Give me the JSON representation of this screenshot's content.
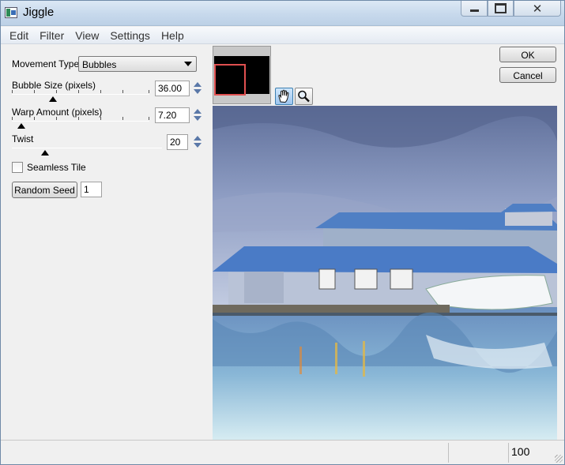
{
  "window": {
    "title": "Jiggle"
  },
  "menu": [
    "Edit",
    "Filter",
    "View",
    "Settings",
    "Help"
  ],
  "controls": {
    "movement_type": {
      "label": "Movement Type:",
      "value": "Bubbles"
    },
    "bubble_size": {
      "label": "Bubble Size (pixels)",
      "value": "36.00",
      "slider_fraction": 0.3
    },
    "warp_amount": {
      "label": "Warp Amount (pixels)",
      "value": "7.20",
      "slider_fraction": 0.07
    },
    "twist": {
      "label": "Twist",
      "value": "20",
      "slider_fraction": 0.22
    },
    "seamless_tile": {
      "label": "Seamless Tile",
      "checked": false
    },
    "random_seed": {
      "button_label": "Random Seed",
      "value": "1"
    }
  },
  "actions": {
    "ok": "OK",
    "cancel": "Cancel"
  },
  "preview_tools": [
    "hand-icon",
    "magnifier-icon"
  ],
  "status": {
    "zoom": "100"
  }
}
